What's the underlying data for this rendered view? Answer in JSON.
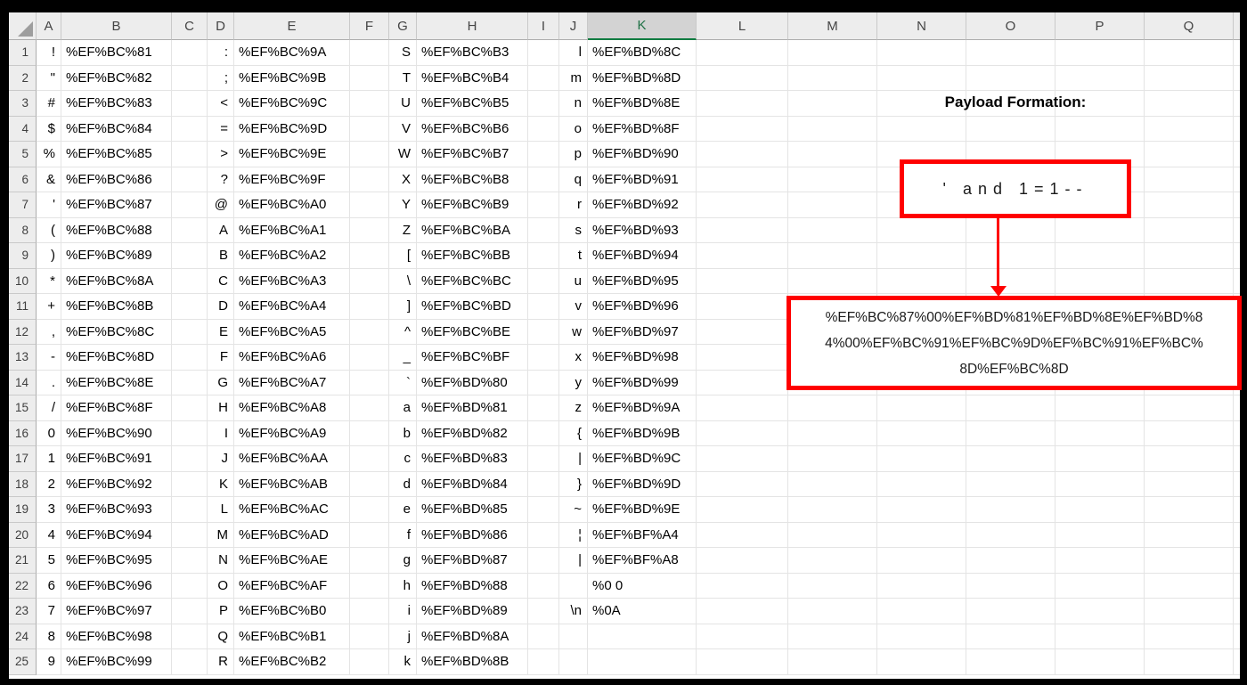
{
  "colors": {
    "shape_red": "#FF0000",
    "selected_header_green": "#107C41",
    "selected_header_text": "#1E7145"
  },
  "sheet": {
    "select_all": "",
    "selected_column": "K",
    "columns": [
      "A",
      "B",
      "C",
      "D",
      "E",
      "F",
      "G",
      "H",
      "I",
      "J",
      "K",
      "L",
      "M",
      "N",
      "O",
      "P",
      "Q"
    ],
    "rows": [
      {
        "n": "1",
        "a": "!",
        "b": "%EF%BC%81",
        "d": ":",
        "e": "%EF%BC%9A",
        "g": "S",
        "h": "%EF%BC%B3",
        "j": "l",
        "k": "%EF%BD%8C"
      },
      {
        "n": "2",
        "a": "\"",
        "b": "%EF%BC%82",
        "d": ";",
        "e": "%EF%BC%9B",
        "g": "T",
        "h": "%EF%BC%B4",
        "j": "m",
        "k": "%EF%BD%8D"
      },
      {
        "n": "3",
        "a": "#",
        "b": "%EF%BC%83",
        "d": "<",
        "e": "%EF%BC%9C",
        "g": "U",
        "h": "%EF%BC%B5",
        "j": "n",
        "k": "%EF%BD%8E"
      },
      {
        "n": "4",
        "a": "$",
        "b": "%EF%BC%84",
        "d": "=",
        "e": "%EF%BC%9D",
        "g": "V",
        "h": "%EF%BC%B6",
        "j": "o",
        "k": "%EF%BD%8F"
      },
      {
        "n": "5",
        "a": "%",
        "b": "%EF%BC%85",
        "d": ">",
        "e": "%EF%BC%9E",
        "g": "W",
        "h": "%EF%BC%B7",
        "j": "p",
        "k": "%EF%BD%90"
      },
      {
        "n": "6",
        "a": "&",
        "b": "%EF%BC%86",
        "d": "?",
        "e": "%EF%BC%9F",
        "g": "X",
        "h": "%EF%BC%B8",
        "j": "q",
        "k": "%EF%BD%91"
      },
      {
        "n": "7",
        "a": "'",
        "b": "%EF%BC%87",
        "d": "@",
        "e": "%EF%BC%A0",
        "g": "Y",
        "h": "%EF%BC%B9",
        "j": "r",
        "k": "%EF%BD%92"
      },
      {
        "n": "8",
        "a": "(",
        "b": "%EF%BC%88",
        "d": "A",
        "e": "%EF%BC%A1",
        "g": "Z",
        "h": "%EF%BC%BA",
        "j": "s",
        "k": "%EF%BD%93"
      },
      {
        "n": "9",
        "a": ")",
        "b": "%EF%BC%89",
        "d": "B",
        "e": "%EF%BC%A2",
        "g": "[",
        "h": "%EF%BC%BB",
        "j": "t",
        "k": "%EF%BD%94"
      },
      {
        "n": "10",
        "a": "*",
        "b": "%EF%BC%8A",
        "d": "C",
        "e": "%EF%BC%A3",
        "g": "\\",
        "h": "%EF%BC%BC",
        "j": "u",
        "k": "%EF%BD%95"
      },
      {
        "n": "11",
        "a": "+",
        "b": "%EF%BC%8B",
        "d": "D",
        "e": "%EF%BC%A4",
        "g": "]",
        "h": "%EF%BC%BD",
        "j": "v",
        "k": "%EF%BD%96"
      },
      {
        "n": "12",
        "a": ",",
        "b": "%EF%BC%8C",
        "d": "E",
        "e": "%EF%BC%A5",
        "g": "^",
        "h": "%EF%BC%BE",
        "j": "w",
        "k": "%EF%BD%97"
      },
      {
        "n": "13",
        "a": "-",
        "b": "%EF%BC%8D",
        "d": "F",
        "e": "%EF%BC%A6",
        "g": "_",
        "h": "%EF%BC%BF",
        "j": "x",
        "k": "%EF%BD%98"
      },
      {
        "n": "14",
        "a": ".",
        "b": "%EF%BC%8E",
        "d": "G",
        "e": "%EF%BC%A7",
        "g": "`",
        "h": "%EF%BD%80",
        "j": "y",
        "k": "%EF%BD%99"
      },
      {
        "n": "15",
        "a": "/",
        "b": "%EF%BC%8F",
        "d": "H",
        "e": "%EF%BC%A8",
        "g": "a",
        "h": "%EF%BD%81",
        "j": "z",
        "k": "%EF%BD%9A"
      },
      {
        "n": "16",
        "a": "0",
        "b": "%EF%BC%90",
        "d": "I",
        "e": "%EF%BC%A9",
        "g": "b",
        "h": "%EF%BD%82",
        "j": "{",
        "k": "%EF%BD%9B"
      },
      {
        "n": "17",
        "a": "1",
        "b": "%EF%BC%91",
        "d": "J",
        "e": "%EF%BC%AA",
        "g": "c",
        "h": "%EF%BD%83",
        "j": "|",
        "k": "%EF%BD%9C"
      },
      {
        "n": "18",
        "a": "2",
        "b": "%EF%BC%92",
        "d": "K",
        "e": "%EF%BC%AB",
        "g": "d",
        "h": "%EF%BD%84",
        "j": "}",
        "k": "%EF%BD%9D"
      },
      {
        "n": "19",
        "a": "3",
        "b": "%EF%BC%93",
        "d": "L",
        "e": "%EF%BC%AC",
        "g": "e",
        "h": "%EF%BD%85",
        "j": "~",
        "k": "%EF%BD%9E"
      },
      {
        "n": "20",
        "a": "4",
        "b": "%EF%BC%94",
        "d": "M",
        "e": "%EF%BC%AD",
        "g": "f",
        "h": "%EF%BD%86",
        "j": "¦",
        "k": "%EF%BF%A4"
      },
      {
        "n": "21",
        "a": "5",
        "b": "%EF%BC%95",
        "d": "N",
        "e": "%EF%BC%AE",
        "g": "g",
        "h": "%EF%BD%87",
        "j": "|",
        "k": "%EF%BF%A8"
      },
      {
        "n": "22",
        "a": "6",
        "b": "%EF%BC%96",
        "d": "O",
        "e": "%EF%BC%AF",
        "g": "h",
        "h": "%EF%BD%88",
        "j": "",
        "k": "%0 0"
      },
      {
        "n": "23",
        "a": "7",
        "b": "%EF%BC%97",
        "d": "P",
        "e": "%EF%BC%B0",
        "g": "i",
        "h": "%EF%BD%89",
        "j": "\\n",
        "k": "%0A"
      },
      {
        "n": "24",
        "a": "8",
        "b": "%EF%BC%98",
        "d": "Q",
        "e": "%EF%BC%B1",
        "g": "j",
        "h": "%EF%BD%8A",
        "j": "",
        "k": ""
      },
      {
        "n": "25",
        "a": "9",
        "b": "%EF%BC%99",
        "d": "R",
        "e": "%EF%BC%B2",
        "g": "k",
        "h": "%EF%BD%8B",
        "j": "",
        "k": ""
      }
    ]
  },
  "annotation": {
    "title": "Payload Formation:",
    "payload_plain": "' and 1=1--",
    "payload_encoded_lines": [
      "%EF%BC%87%00%EF%BD%81%EF%BD%8E%EF%BD%8",
      "4%00%EF%BC%91%EF%BC%9D%EF%BC%91%EF%BC%",
      "8D%EF%BC%8D"
    ]
  }
}
